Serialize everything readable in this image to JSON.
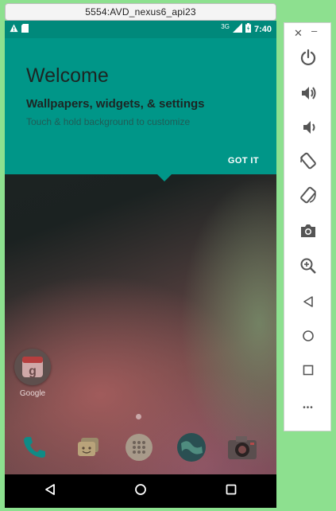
{
  "window": {
    "title": "5554:AVD_nexus6_api23"
  },
  "status_bar": {
    "left_icons": [
      "warning-icon",
      "sd-card-icon"
    ],
    "right_icons": [
      "signal-icon",
      "battery-icon"
    ],
    "network": "3G",
    "time": "7:40"
  },
  "cling": {
    "title": "Welcome",
    "subtitle": "Wallpapers, widgets, & settings",
    "hint": "Touch & hold background to customize",
    "button": "GOT IT"
  },
  "home": {
    "folder": {
      "label": "Google",
      "icon": "google-folder-icon"
    },
    "hotseat": [
      "phone-app-icon",
      "messenger-app-icon",
      "app-drawer-icon",
      "browser-app-icon",
      "camera-app-icon"
    ]
  },
  "nav_bar": [
    "back-icon",
    "home-icon",
    "recents-icon"
  ],
  "side_panel": {
    "buttons": [
      "power-icon",
      "volume-up-icon",
      "volume-down-icon",
      "rotate-left-icon",
      "rotate-right-icon",
      "camera-icon",
      "zoom-icon",
      "back-icon",
      "home-icon",
      "overview-icon",
      "more-icon"
    ],
    "more": "•••"
  },
  "colors": {
    "accent": "#009688",
    "status_bar": "#00897b",
    "background": "#8de08f"
  }
}
